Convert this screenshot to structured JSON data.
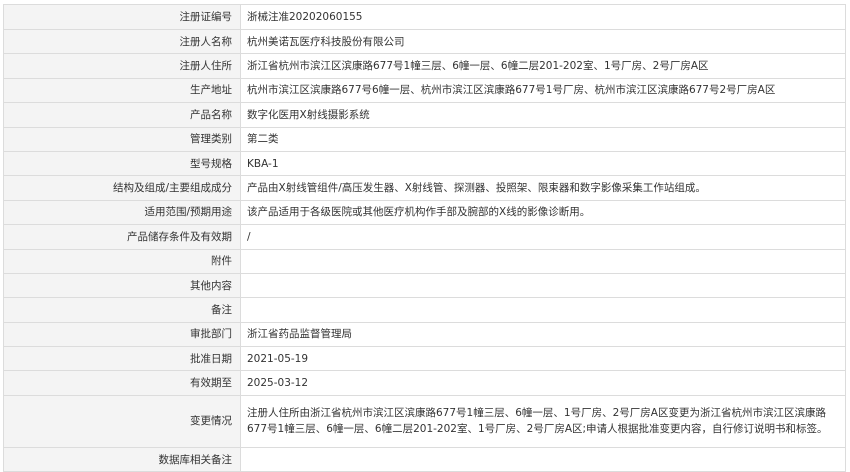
{
  "rows": [
    {
      "label": "注册证编号",
      "value": "浙械注准20202060155"
    },
    {
      "label": "注册人名称",
      "value": "杭州美诺瓦医疗科技股份有限公司"
    },
    {
      "label": "注册人住所",
      "value": "浙江省杭州市滨江区滨康路677号1幢三层、6幢一层、6幢二层201-202室、1号厂房、2号厂房A区"
    },
    {
      "label": "生产地址",
      "value": "杭州市滨江区滨康路677号6幢一层、杭州市滨江区滨康路677号1号厂房、杭州市滨江区滨康路677号2号厂房A区"
    },
    {
      "label": "产品名称",
      "value": "数字化医用X射线摄影系统"
    },
    {
      "label": "管理类别",
      "value": "第二类"
    },
    {
      "label": "型号规格",
      "value": "KBA-1"
    },
    {
      "label": "结构及组成/主要组成成分",
      "value": "产品由X射线管组件/高压发生器、X射线管、探测器、投照架、限束器和数字影像采集工作站组成。"
    },
    {
      "label": "适用范围/预期用途",
      "value": "该产品适用于各级医院或其他医疗机构作手部及腕部的X线的影像诊断用。"
    },
    {
      "label": "产品储存条件及有效期",
      "value": "/"
    },
    {
      "label": "附件",
      "value": ""
    },
    {
      "label": "其他内容",
      "value": ""
    },
    {
      "label": "备注",
      "value": ""
    },
    {
      "label": "审批部门",
      "value": "浙江省药品监督管理局"
    },
    {
      "label": "批准日期",
      "value": "2021-05-19"
    },
    {
      "label": "有效期至",
      "value": "2025-03-12"
    },
    {
      "label": "变更情况",
      "value": "注册人住所由浙江省杭州市滨江区滨康路677号1幢三层、6幢一层、1号厂房、2号厂房A区变更为浙江省杭州市滨江区滨康路677号1幢三层、6幢一层、6幢二层201-202室、1号厂房、2号厂房A区;申请人根据批准变更内容，自行修订说明书和标签。"
    },
    {
      "label": "数据库相关备注",
      "value": ""
    }
  ]
}
